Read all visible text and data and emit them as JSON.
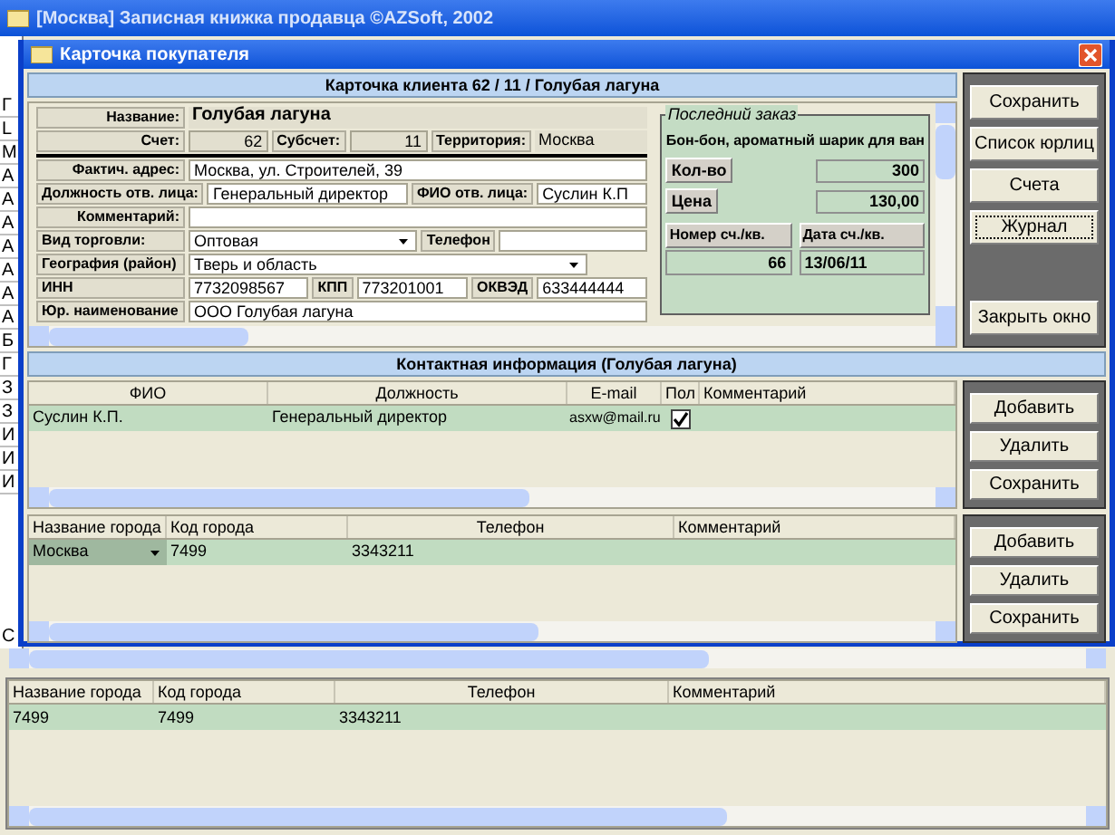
{
  "window": {
    "title": "[Москва] Записная книжка продавца ©AZSoft, 2002"
  },
  "background_list": {
    "items": [
      "Г",
      "L",
      "М",
      "А",
      "А",
      "А",
      "А",
      "А",
      "А",
      "А",
      "Б",
      "Г",
      "З",
      "З",
      "И",
      "И",
      "И"
    ],
    "footer": "С"
  },
  "dialog": {
    "title": "Карточка покупателя"
  },
  "client": {
    "header": "Карточка клиента 62 / 11 / Голубая лагуна",
    "rows": [
      {
        "kind": "right-labels",
        "fields": [
          {
            "label": "Название:",
            "value": "Голубая лагуна",
            "kind": "title"
          }
        ]
      },
      {
        "kind": "right-labels",
        "fields": [
          {
            "label": "Счет:",
            "value": "62",
            "kind": "number"
          },
          {
            "label": "Субсчет:",
            "value": "11",
            "kind": "number"
          },
          {
            "label": "Территория:",
            "value": "Москва",
            "kind": "readonly"
          }
        ]
      },
      {
        "kind": "separator",
        "fields": []
      },
      {
        "kind": "right-labels",
        "fields": [
          {
            "label": "Фактич. адрес:",
            "value": "Москва, ул. Строителей, 39",
            "kind": "input"
          }
        ]
      },
      {
        "kind": "right-labels",
        "fields": [
          {
            "label": "Должность отв. лица:",
            "value": "Генеральный директор",
            "kind": "input"
          },
          {
            "label": "ФИО отв. лица:",
            "value": "Суслин К.П",
            "kind": "input"
          }
        ]
      },
      {
        "kind": "right-labels",
        "fields": [
          {
            "label": "Комментарий:",
            "kind": "input"
          }
        ]
      },
      {
        "kind": "left-labels",
        "fields": [
          {
            "label": "Вид торговли:",
            "value": "Оптовая",
            "kind": "select"
          },
          {
            "label": "Телефон",
            "kind": "input"
          }
        ]
      },
      {
        "kind": "left-labels",
        "fields": [
          {
            "label": "География (район)",
            "value": "Тверь и область",
            "kind": "select"
          }
        ]
      },
      {
        "kind": "left-labels",
        "fields": [
          {
            "label": "ИНН",
            "value": "7732098567",
            "kind": "input"
          },
          {
            "label": "КПП",
            "value": "773201001",
            "kind": "input"
          },
          {
            "label": "ОКВЭД",
            "value": "633444444",
            "kind": "input"
          }
        ]
      },
      {
        "kind": "left-labels",
        "fields": [
          {
            "label": "Юр. наименование",
            "value": "ООО Голубая лагуна",
            "kind": "input"
          }
        ]
      }
    ],
    "last_order": {
      "title": "Последний заказ",
      "product": "Бон-бон, ароматный шарик для ван",
      "quantity": {
        "label": "Кол-во",
        "value": "300"
      },
      "price": {
        "label": "Цена",
        "value": "130,00"
      },
      "invoice_number": {
        "label": "Номер сч./кв.",
        "value": "66"
      },
      "invoice_date": {
        "label": "Дата сч./кв.",
        "value": "13/06/11"
      }
    }
  },
  "client_buttons": [
    {
      "label": "Сохранить",
      "focused": false
    },
    {
      "label": "Список юрлиц",
      "focused": false
    },
    {
      "label": "Счета",
      "focused": false
    },
    {
      "label": "Журнал",
      "focused": true
    },
    {
      "label": "Закрыть окно",
      "focused": false
    }
  ],
  "contacts": {
    "header": "Контактная информация (Голубая лагуна)",
    "columns": [
      "ФИО",
      "Должность",
      "E-mail",
      "Пол",
      "Комментарий"
    ],
    "rows": [
      {
        "name": "Суслин К.П.",
        "position": "Генеральный директор",
        "email": "asxw@mail.ru",
        "checked": true
      }
    ]
  },
  "contact_buttons": [
    "Добавить",
    "Удалить",
    "Сохранить"
  ],
  "phones": {
    "columns": [
      "Название города",
      "Код города",
      "Телефон",
      "Комментарий"
    ],
    "rows": [
      {
        "city": "Москва",
        "code": "7499",
        "phone": "3343211"
      }
    ]
  },
  "phone_buttons": [
    "Добавить",
    "Удалить",
    "Сохранить"
  ],
  "main_phones": {
    "columns": [
      "Название города",
      "Код города",
      "Телефон",
      "Комментарий"
    ],
    "rows": [
      {
        "city": "7499",
        "code": "7499",
        "phone": "3343211"
      }
    ]
  }
}
